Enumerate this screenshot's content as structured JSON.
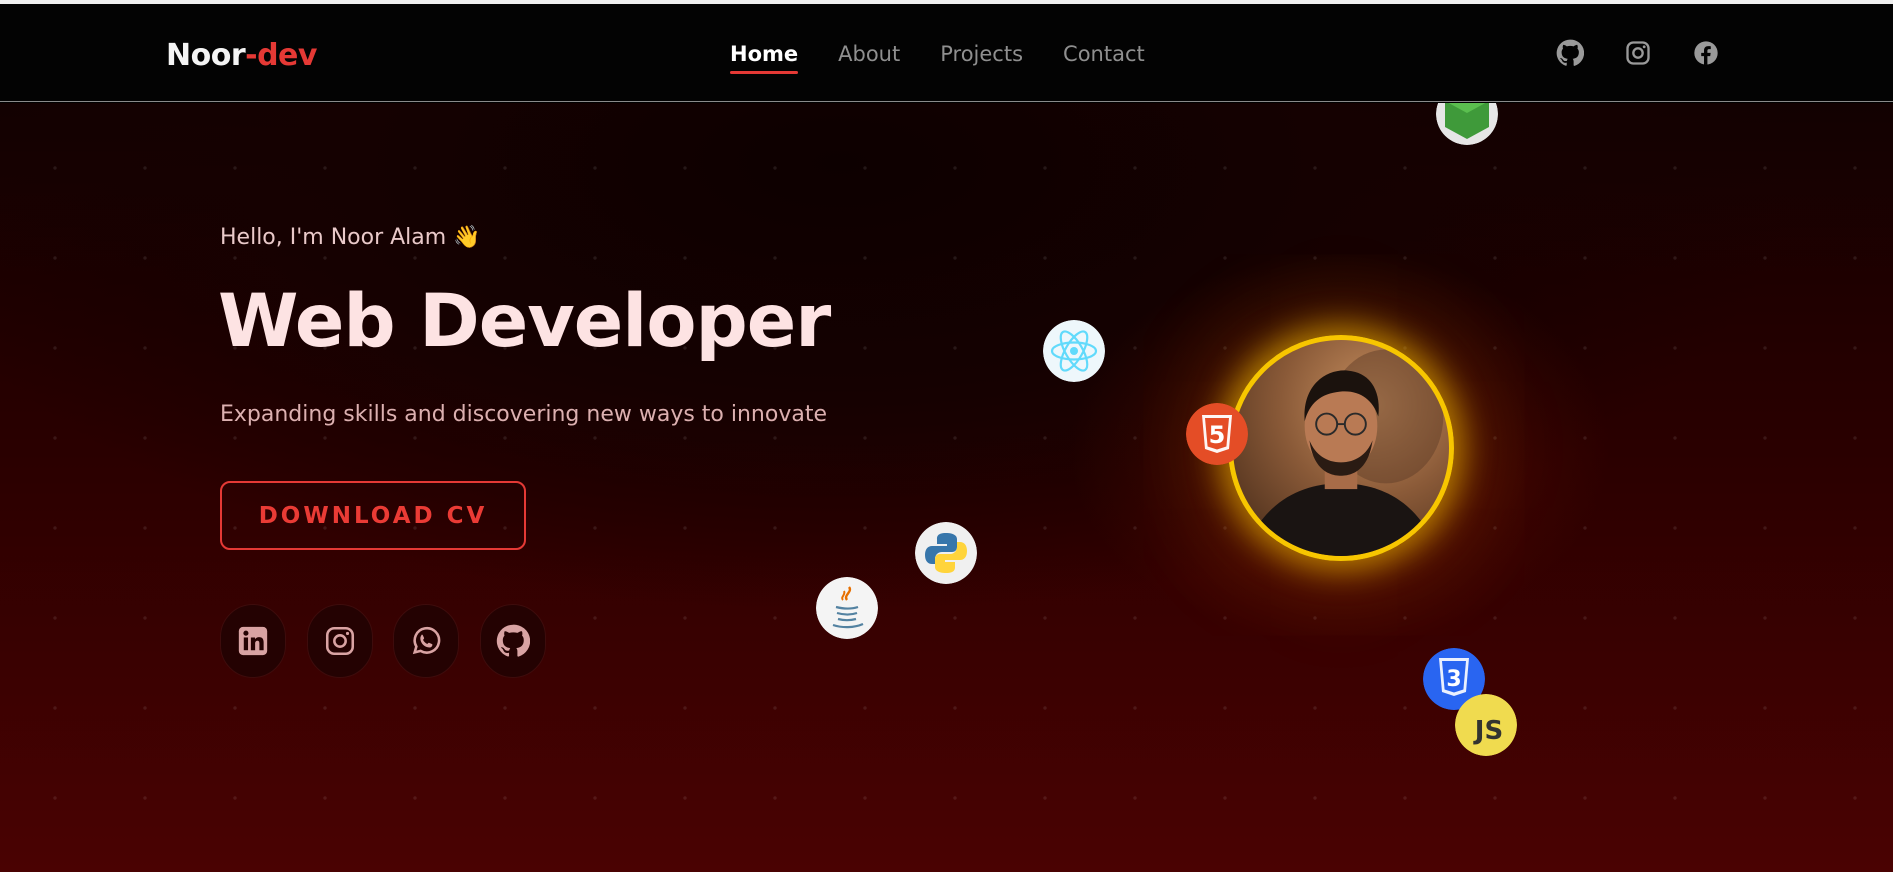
{
  "brand": {
    "part1": "Noor",
    "part2": "-dev"
  },
  "nav": {
    "links": [
      "Home",
      "About",
      "Projects",
      "Contact"
    ],
    "active": "Home",
    "social_icons": [
      "github-icon",
      "instagram-icon",
      "facebook-icon"
    ]
  },
  "hero": {
    "greeting": "Hello, I'm Noor Alam 👋",
    "headline": "Web Developer",
    "tagline": "Expanding skills and discovering new ways to innovate",
    "cv_button": "DOWNLOAD CV",
    "social_icons": [
      "linkedin-icon",
      "instagram-icon",
      "whatsapp-icon",
      "github-icon"
    ],
    "css_badge": "3",
    "js_badge": "JS",
    "html_badge": "5"
  },
  "colors": {
    "accent": "#e53935",
    "glow": "#f7c600",
    "headline": "#fde3e3",
    "background": "#000000"
  }
}
